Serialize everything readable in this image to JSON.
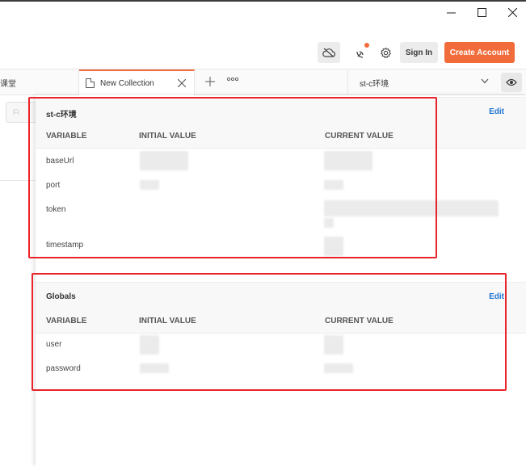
{
  "window": {
    "controls": {
      "minimize": "minimize",
      "maximize": "maximize",
      "close": "close"
    }
  },
  "header": {
    "signin_label": "Sign In",
    "create_account_label": "Create Account",
    "accent_color": "#f26b3a"
  },
  "tabs": {
    "previous_tab_fragment": "课堂",
    "active_tab_label": "New Collection"
  },
  "environment": {
    "selected": "st-c环境"
  },
  "sidebar": {
    "button_fragment": "Fi"
  },
  "sections": [
    {
      "title": "st-c环境",
      "edit_label": "Edit",
      "columns": [
        "VARIABLE",
        "INITIAL VALUE",
        "CURRENT VALUE"
      ],
      "rows": [
        {
          "variable": "baseUrl"
        },
        {
          "variable": "port"
        },
        {
          "variable": "token"
        },
        {
          "variable": "timestamp"
        }
      ]
    },
    {
      "title": "Globals",
      "edit_label": "Edit",
      "columns": [
        "VARIABLE",
        "INITIAL VALUE",
        "CURRENT VALUE"
      ],
      "rows": [
        {
          "variable": "user"
        },
        {
          "variable": "password"
        }
      ]
    }
  ],
  "annotation_color": "#e8242a"
}
